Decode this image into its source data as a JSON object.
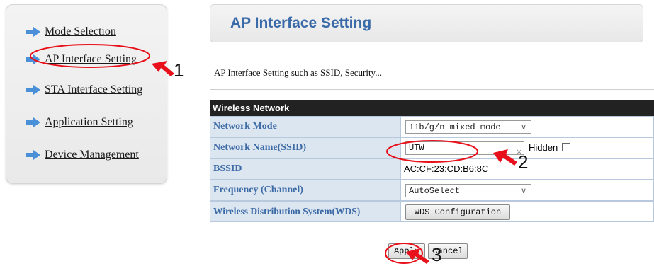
{
  "sidebar": {
    "items": [
      {
        "label": "Mode Selection"
      },
      {
        "label": "AP Interface Setting"
      },
      {
        "label": "STA Interface Setting"
      },
      {
        "label": "Application Setting"
      },
      {
        "label": "Device Management"
      }
    ]
  },
  "header": {
    "title": "AP Interface Setting"
  },
  "description": "AP Interface Setting such as SSID, Security...",
  "table": {
    "header": "Wireless Network",
    "rows": {
      "mode": {
        "label": "Network Mode",
        "value": "11b/g/n mixed mode"
      },
      "ssid": {
        "label": "Network Name(SSID)",
        "value": "UTW",
        "hidden_label": "Hidden",
        "hidden_checked": false
      },
      "bssid": {
        "label": "BSSID",
        "value": "AC:CF:23:CD:B6:8C"
      },
      "freq": {
        "label": "Frequency (Channel)",
        "value": "AutoSelect"
      },
      "wds": {
        "label": "Wireless Distribution System(WDS)",
        "button": "WDS Configuration"
      }
    }
  },
  "buttons": {
    "apply": "Apply",
    "cancel": "Cancel"
  },
  "annotations": {
    "n1": "1",
    "n2": "2",
    "n3": "3",
    "arrow_color": "#e8101a",
    "ellipse_color": "#e8101a"
  },
  "colors": {
    "header_title": "#3a6aa8",
    "label_text": "#3c6aa5",
    "label_bg": "#dce6f1",
    "table_header_bg": "#222222",
    "arrow_icon": "#4a90d9"
  }
}
